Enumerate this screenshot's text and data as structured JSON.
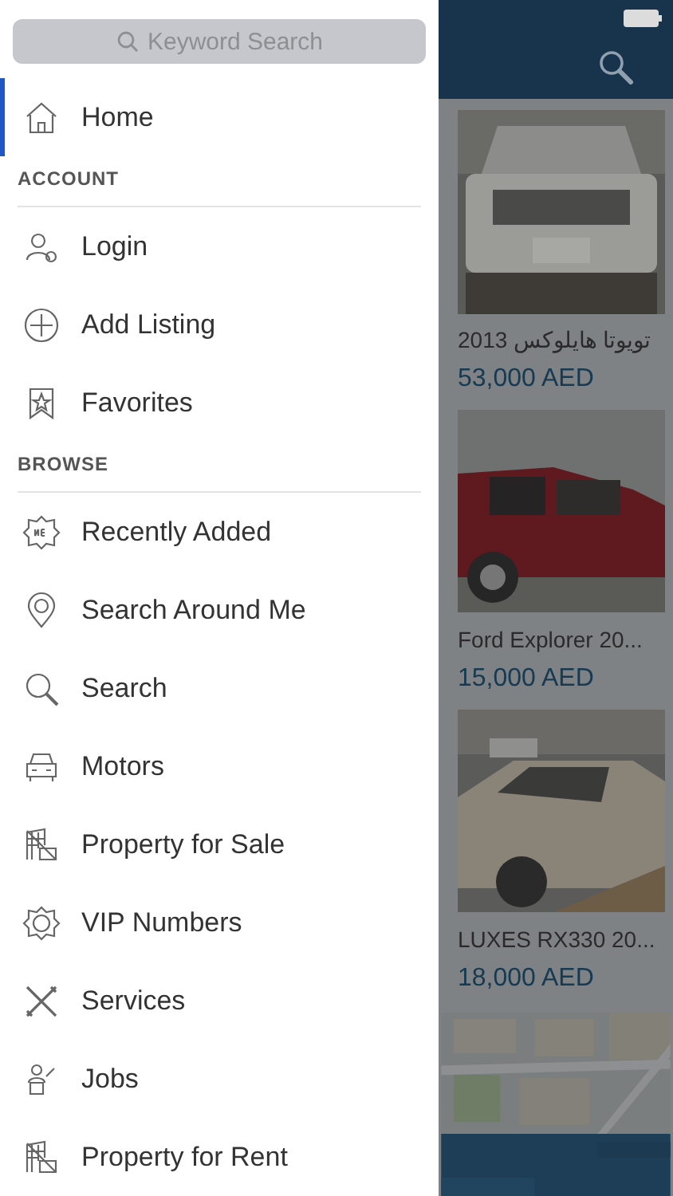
{
  "drawer": {
    "search": {
      "placeholder": "Keyword Search"
    },
    "items": [
      {
        "kind": "item",
        "label": "Home",
        "selected": true
      },
      {
        "kind": "header",
        "label": "ACCOUNT"
      },
      {
        "kind": "item",
        "label": "Login",
        "selected": false
      },
      {
        "kind": "item",
        "label": "Add Listing",
        "selected": false
      },
      {
        "kind": "item",
        "label": "Favorites",
        "selected": false
      },
      {
        "kind": "header",
        "label": "BROWSE"
      },
      {
        "kind": "item",
        "label": "Recently Added",
        "selected": false
      },
      {
        "kind": "item",
        "label": "Search Around Me",
        "selected": false
      },
      {
        "kind": "item",
        "label": "Search",
        "selected": false
      },
      {
        "kind": "item",
        "label": "Motors",
        "selected": false
      },
      {
        "kind": "item",
        "label": "Property for Sale",
        "selected": false
      },
      {
        "kind": "item",
        "label": "VIP Numbers",
        "selected": false
      },
      {
        "kind": "item",
        "label": "Services",
        "selected": false
      },
      {
        "kind": "item",
        "label": "Jobs",
        "selected": false
      },
      {
        "kind": "item",
        "label": "Property for Rent",
        "selected": false
      }
    ]
  },
  "listings": [
    {
      "title": "تويوتا هايلوكس 2013",
      "price": "53,000 AED"
    },
    {
      "title": "Ford Explorer 20...",
      "price": "15,000 AED"
    },
    {
      "title": "LUXES RX330 20...",
      "price": "18,000 AED"
    }
  ]
}
